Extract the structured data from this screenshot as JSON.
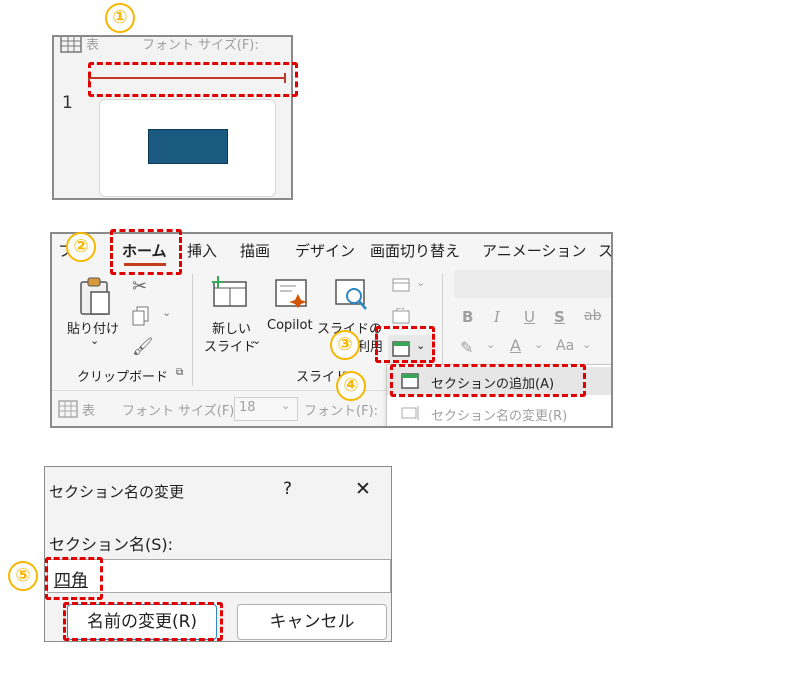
{
  "steps": {
    "s1": "①",
    "s2": "②",
    "s3": "③",
    "s4": "④",
    "s5": "⑤"
  },
  "panel1": {
    "toolbar_left": "表",
    "toolbar_font": "フォント サイズ(F):",
    "slide_number": "1",
    "rect_color": "#1a5a80"
  },
  "ribbon": {
    "tabs": {
      "file": "フ",
      "home": "ホーム",
      "insert": "挿入",
      "draw": "描画",
      "design": "デザイン",
      "transitions": "画面切り替え",
      "animations": "アニメーション",
      "slideshow": "ス"
    },
    "paste_label": "貼り付け",
    "clipboard_group": "クリップボード",
    "new_slide_line1": "新しい",
    "new_slide_line2": "スライド",
    "copilot_label": "Copilot",
    "reuse_line1": "スライドの",
    "reuse_line2": "再利用",
    "slides_group": "スライド",
    "font_bold": "B",
    "font_italic": "I",
    "font_underline": "U",
    "font_shadow": "S",
    "font_strike": "ab",
    "font_case": "Aa",
    "bottom_table": "表",
    "bottom_font_size_label": "フォント サイズ(F):",
    "bottom_font_size_value": "18",
    "bottom_font_label": "フォント(F):"
  },
  "section_menu": {
    "add_section": "セクションの追加(A)",
    "rename_section": "セクション名の変更(R)"
  },
  "dialog": {
    "title": "セクション名の変更",
    "help": "?",
    "close": "✕",
    "field_label": "セクション名(S):",
    "field_value": "四角",
    "rename_button": "名前の変更(R)",
    "cancel_button": "キャンセル"
  },
  "colors": {
    "accent_red": "#e00000",
    "step_yellow": "#f5b700",
    "home_underline": "#c43e1c",
    "slide_rect": "#1a5a80"
  }
}
